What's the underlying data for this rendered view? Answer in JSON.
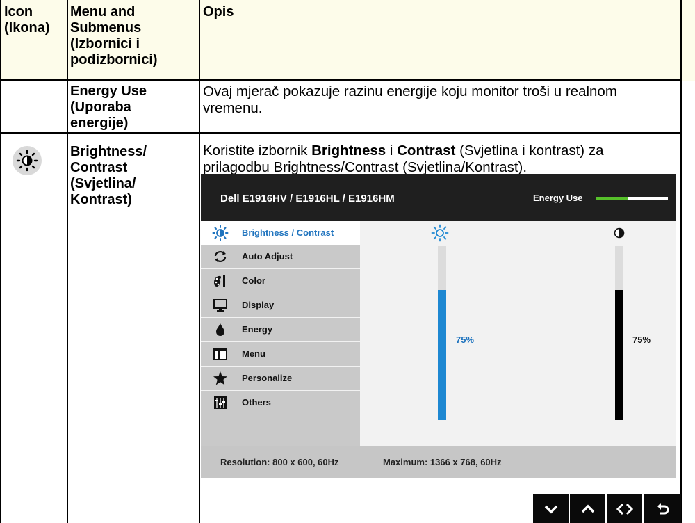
{
  "table": {
    "headers": {
      "icon": [
        "Icon",
        "(Ikona)"
      ],
      "menu": [
        "Menu and",
        "Submenus",
        "(Izbornici i",
        "podizbornici)"
      ],
      "desc": "Opis"
    },
    "rows": [
      {
        "menu": [
          "Energy Use",
          "(Uporaba",
          "energije)"
        ],
        "desc": [
          "Ovaj mjerač pokazuje razinu energije koju monitor troši u realnom",
          "vremenu."
        ]
      },
      {
        "icon": "brightness-contrast-icon",
        "menu": [
          "Brightness/",
          "Contrast",
          "(Svjetlina/",
          "Kontrast)"
        ],
        "desc_line1": {
          "a": "Koristite izbornik ",
          "b": "Brightness",
          "c": " i ",
          "d": "Contrast",
          "e": " (Svjetlina i kontrast) za"
        },
        "desc_line2": "prilagodbu Brightness/Contrast (Svjetlina/Kontrast)."
      }
    ]
  },
  "osd": {
    "title": "Dell E1916HV / E1916HL / E1916HM",
    "energy_use_label": "Energy Use",
    "energy_level": 0.45,
    "menu": [
      {
        "label": "Brightness / Contrast",
        "icon": "brightness-contrast-icon",
        "selected": true
      },
      {
        "label": "Auto Adjust",
        "icon": "auto-adjust-icon"
      },
      {
        "label": "Color",
        "icon": "color-icon"
      },
      {
        "label": "Display",
        "icon": "display-icon"
      },
      {
        "label": "Energy",
        "icon": "energy-icon"
      },
      {
        "label": "Menu",
        "icon": "menu-icon"
      },
      {
        "label": "Personalize",
        "icon": "star-icon"
      },
      {
        "label": "Others",
        "icon": "others-icon"
      }
    ],
    "brightness": {
      "value": 75,
      "label": "75%",
      "color": "#1e88d2"
    },
    "contrast": {
      "value": 75,
      "label": "75%",
      "color": "#000000"
    },
    "resolution": "Resolution: 800 x 600, 60Hz",
    "maximum": "Maximum: 1366 x 768, 60Hz"
  },
  "nav_buttons": [
    "down-icon",
    "up-icon",
    "left-right-icon",
    "back-icon"
  ],
  "colors": {
    "header_bg": "#fdfcea",
    "accent": "#1e73be",
    "energy_green": "#56c02a"
  }
}
